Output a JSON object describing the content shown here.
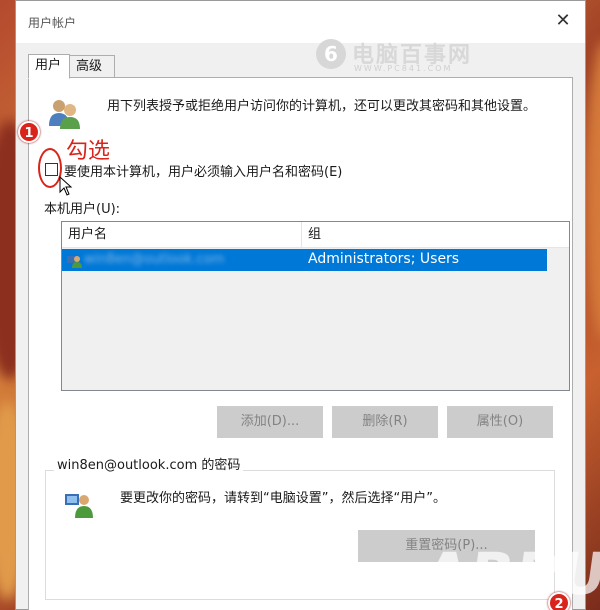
{
  "dialog": {
    "title": "用户帐户",
    "close_glyph": "✕"
  },
  "watermark_top": {
    "logo": "6",
    "text": "电脑百事网",
    "sub": "WWW.PC841.COM"
  },
  "tabs": [
    {
      "label": "用户",
      "active": true
    },
    {
      "label": "高级",
      "active": false
    }
  ],
  "intro": {
    "text": "用下列表授予或拒绝用户访问你的计算机，还可以更改其密码和其他设置。"
  },
  "annotations": {
    "step1": "1",
    "step1_label": "勾选",
    "step2": "2"
  },
  "require_login": {
    "label": "要使用本计算机，用户必须输入用户名和密码(E)",
    "checked": false
  },
  "users_section": {
    "label": "本机用户(U):",
    "columns": [
      "用户名",
      "组"
    ],
    "rows": [
      {
        "username": "win8en@outlook.com",
        "group": "Administrators; Users",
        "selected": true
      }
    ]
  },
  "buttons": {
    "add": "添加(D)...",
    "remove": "删除(R)",
    "properties": "属性(O)"
  },
  "password_group": {
    "legend": "win8en@outlook.com 的密码",
    "text": "要更改你的密码，请转到“电脑设置”，然后选择“用户”。",
    "reset_button": "重置密码(P)..."
  },
  "bottom_watermark": "ARPUN.COM"
}
